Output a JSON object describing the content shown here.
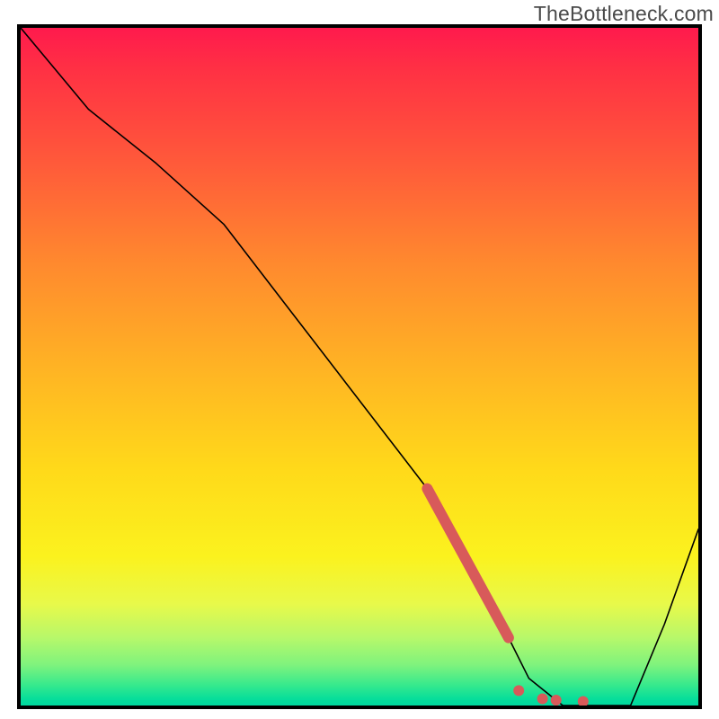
{
  "watermark": "TheBottleneck.com",
  "colors": {
    "accent": "#d85a5a",
    "curve": "#000000",
    "border": "#000000",
    "gradient_top": "#ff1a4d",
    "gradient_bottom": "#00d8a0"
  },
  "chart_data": {
    "type": "line",
    "title": "",
    "xlabel": "",
    "ylabel": "",
    "xlim": [
      0,
      100
    ],
    "ylim": [
      0,
      100
    ],
    "grid": false,
    "x": [
      0,
      5,
      10,
      20,
      30,
      40,
      50,
      60,
      63,
      67,
      72,
      75,
      80,
      85,
      90,
      95,
      100
    ],
    "values": [
      100,
      94,
      88,
      80,
      71,
      58,
      45,
      32,
      26,
      18,
      10,
      4,
      0,
      0,
      0,
      12,
      26
    ],
    "accent_segment": {
      "x": [
        60,
        72
      ],
      "values": [
        32,
        10
      ]
    },
    "accent_dots": [
      {
        "x": 73.5,
        "value": 2.2
      },
      {
        "x": 77,
        "value": 1.0
      },
      {
        "x": 79,
        "value": 0.8
      },
      {
        "x": 83,
        "value": 0.6
      }
    ],
    "background_gradient": {
      "orientation": "vertical",
      "stops": [
        {
          "pos": 0.0,
          "hex": "#ff1a4d"
        },
        {
          "pos": 0.5,
          "hex": "#ffb324"
        },
        {
          "pos": 0.78,
          "hex": "#fbf21e"
        },
        {
          "pos": 1.0,
          "hex": "#00d8a0"
        }
      ]
    }
  }
}
